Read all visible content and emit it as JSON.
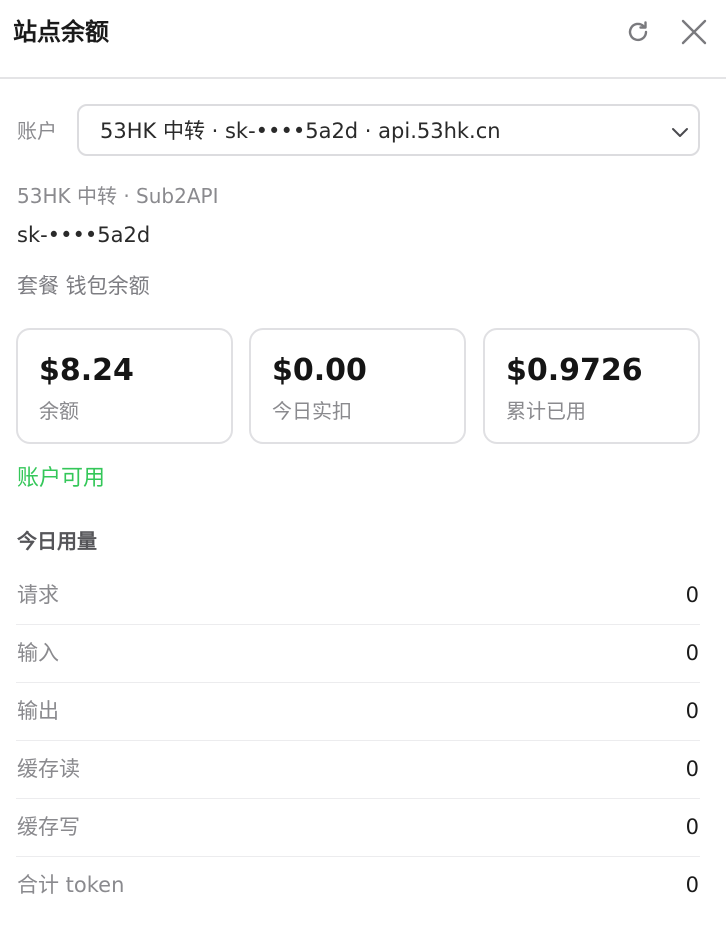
{
  "header": {
    "title": "站点余额",
    "refresh_icon": "refresh-icon",
    "close_icon": "close-icon"
  },
  "account": {
    "label": "账户",
    "selected": "53HK 中转 · sk-••••5a2d · api.53hk.cn"
  },
  "info": {
    "site": "53HK 中转 · Sub2API",
    "key": "sk-••••5a2d",
    "plan": "套餐 钱包余额"
  },
  "stats": [
    {
      "value": "$8.24",
      "label": "余额"
    },
    {
      "value": "$0.00",
      "label": "今日实扣"
    },
    {
      "value": "$0.9726",
      "label": "累计已用"
    }
  ],
  "status": {
    "text": "账户可用",
    "color": "#34c759"
  },
  "usage": {
    "title": "今日用量",
    "rows": [
      {
        "name": "请求",
        "value": "0"
      },
      {
        "name": "输入",
        "value": "0"
      },
      {
        "name": "输出",
        "value": "0"
      },
      {
        "name": "缓存读",
        "value": "0"
      },
      {
        "name": "缓存写",
        "value": "0"
      },
      {
        "name": "合计 token",
        "value": "0"
      }
    ]
  }
}
